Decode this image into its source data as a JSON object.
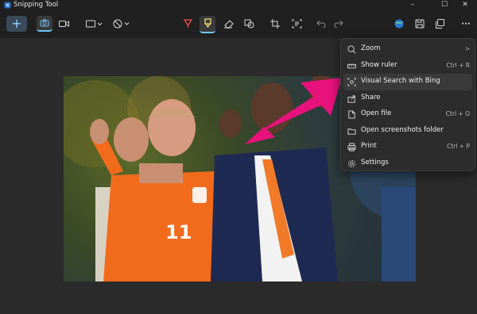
{
  "window": {
    "title": "Snipping Tool",
    "controls": {
      "minimize": "–",
      "maximize": "☐",
      "close": "✕"
    }
  },
  "toolbar": {
    "new_label": "+",
    "more_label": "···"
  },
  "menu": {
    "items": [
      {
        "label": "Zoom",
        "shortcut": ">",
        "icon": "zoom-icon"
      },
      {
        "label": "Show ruler",
        "shortcut": "Ctrl + R",
        "icon": "ruler-icon"
      },
      {
        "label": "Visual Search with Bing",
        "shortcut": "",
        "icon": "visual-search-icon",
        "highlighted": true
      },
      {
        "label": "Share",
        "shortcut": "",
        "icon": "share-icon"
      },
      {
        "label": "Open file",
        "shortcut": "Ctrl + O",
        "icon": "open-file-icon"
      },
      {
        "label": "Open screenshots folder",
        "shortcut": "",
        "icon": "folder-icon"
      },
      {
        "label": "Print",
        "shortcut": "Ctrl + P",
        "icon": "print-icon"
      },
      {
        "label": "Settings",
        "shortcut": "",
        "icon": "settings-icon"
      }
    ]
  },
  "photo": {
    "jersey_number": "11"
  },
  "colors": {
    "accent": "#6ec6ff",
    "arrow": "#e8127c",
    "jersey": "#f26b1d"
  }
}
